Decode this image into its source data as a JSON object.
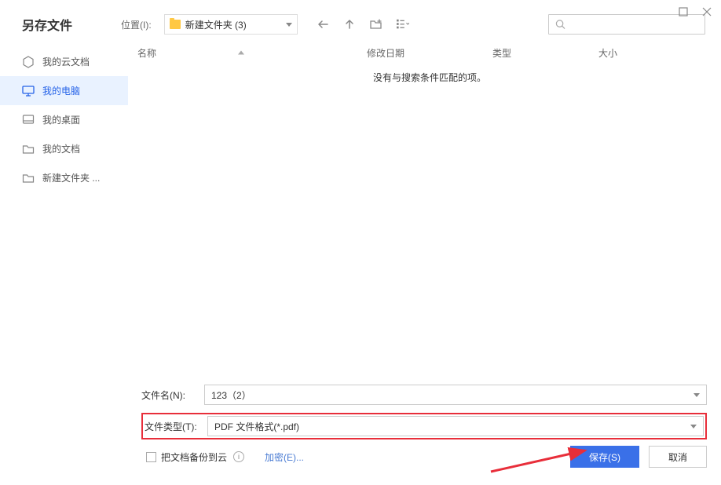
{
  "window": {
    "title": "另存文件"
  },
  "location": {
    "label": "位置(I):",
    "value": "新建文件夹 (3)"
  },
  "sidebar": {
    "items": [
      {
        "label": "我的云文档",
        "icon": "cloud"
      },
      {
        "label": "我的电脑",
        "icon": "monitor"
      },
      {
        "label": "我的桌面",
        "icon": "desktop"
      },
      {
        "label": "我的文档",
        "icon": "folder"
      },
      {
        "label": "新建文件夹 ...",
        "icon": "folder"
      }
    ]
  },
  "columns": {
    "name": "名称",
    "date": "修改日期",
    "type": "类型",
    "size": "大小"
  },
  "content": {
    "empty_message": "没有与搜索条件匹配的项。"
  },
  "filename": {
    "label": "文件名(N):",
    "value": "123（2）"
  },
  "filetype": {
    "label": "文件类型(T):",
    "value": "PDF 文件格式(*.pdf)"
  },
  "options": {
    "backup_label": "把文档备份到云",
    "encrypt_label": "加密(E)..."
  },
  "buttons": {
    "save": "保存(S)",
    "cancel": "取消"
  }
}
